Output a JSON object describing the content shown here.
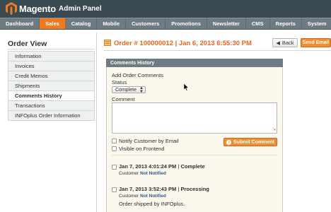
{
  "header": {
    "logo_text": "Magento",
    "logo_sub": "Admin Panel"
  },
  "nav": {
    "items": [
      "Dashboard",
      "Sales",
      "Catalog",
      "Mobile",
      "Customers",
      "Promotions",
      "Newsletter",
      "CMS",
      "Reports",
      "System"
    ],
    "active": "Sales"
  },
  "sidebar": {
    "title": "Order View",
    "items": [
      "Information",
      "Invoices",
      "Credit Memos",
      "Shipments",
      "Comments History",
      "Transactions",
      "INFOplus Order Information"
    ],
    "active": "Comments History"
  },
  "order": {
    "title": "Order # 100000012 | Jan 6, 2013 6:55:30 PM",
    "back_label": "Back",
    "send_email_label": "Send Email"
  },
  "panel": {
    "title": "Comments History",
    "add_title": "Add Order Comments",
    "status_label": "Status",
    "status_value": "Complete",
    "comment_label": "Comment",
    "comment_value": "",
    "notify_label": "Notify Customer by Email",
    "visible_label": "Visible on Frontend",
    "submit_label": "Submit Comment"
  },
  "history": [
    {
      "date": "Jan 7, 2013 4:01:24 PM",
      "status": "Complete",
      "customer_prefix": "Customer",
      "notified": "Not Notified",
      "comment": ""
    },
    {
      "date": "Jan 7, 2013 3:52:43 PM",
      "status": "Processing",
      "customer_prefix": "Customer",
      "notified": "Not Notified",
      "comment": "Order shipped by INFOplus."
    }
  ],
  "colors": {
    "accent": "#f07a1f",
    "header_bg": "#3a4a52",
    "nav_bg": "#6f7b82",
    "order_title": "#e7631b",
    "notified": "#2e5b86"
  }
}
